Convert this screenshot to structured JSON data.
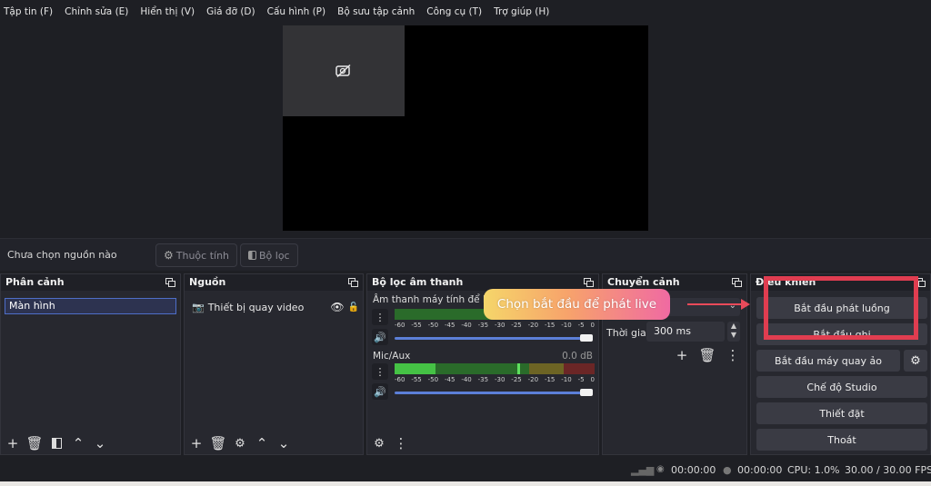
{
  "menu": [
    "Tập tin (F)",
    "Chỉnh sửa (E)",
    "Hiển thị (V)",
    "Giá đỡ (D)",
    "Cấu hình (P)",
    "Bộ sưu tập cảnh",
    "Công cụ (T)",
    "Trợ giúp (H)"
  ],
  "source_toolbar": {
    "no_source_text": "Chưa chọn nguồn nào",
    "properties_label": "Thuộc tính",
    "filters_label": "Bộ lọc"
  },
  "scenes": {
    "title": "Phân cảnh",
    "items": [
      "Màn hình"
    ]
  },
  "sources": {
    "title": "Nguồn",
    "items": [
      {
        "name": "Thiết bị quay video",
        "icon": "camera-icon"
      }
    ]
  },
  "audio_mixer": {
    "title": "Bộ lọc âm thanh",
    "channels": [
      {
        "name": "Âm thanh máy tính để bà",
        "level_fraction": 0.0,
        "volume_fraction": 1.0
      },
      {
        "name": "Mic/Aux",
        "db": "0.0 dB",
        "level_fraction": 0.6,
        "volume_fraction": 1.0
      }
    ],
    "tick_labels": [
      "-60",
      "-55",
      "-50",
      "-45",
      "-40",
      "-35",
      "-30",
      "-25",
      "-20",
      "-15",
      "-10",
      "-5",
      "0"
    ]
  },
  "transitions": {
    "title": "Chuyển cảnh",
    "duration_label": "Thời gian",
    "duration_value": "300 ms"
  },
  "controls": {
    "title": "Điều khiển",
    "start_streaming": "Bắt đầu phát luồng",
    "start_recording": "Bắt đầu ghi",
    "start_virtual_cam": "Bắt đầu máy quay ảo",
    "studio_mode": "Chế độ Studio",
    "settings": "Thiết đặt",
    "exit": "Thoát"
  },
  "status_bar": {
    "stream_time": "00:00:00",
    "record_time": "00:00:00",
    "cpu": "CPU: 1.0%",
    "fps": "30.00 / 30.00 FPS"
  },
  "annotation": {
    "callout_text": "Chọn bắt đầu để phát live",
    "color": "#e03d50"
  },
  "colors": {
    "background": "#1e1f24",
    "dock": "#27282f",
    "accent": "#5c7fd8"
  }
}
